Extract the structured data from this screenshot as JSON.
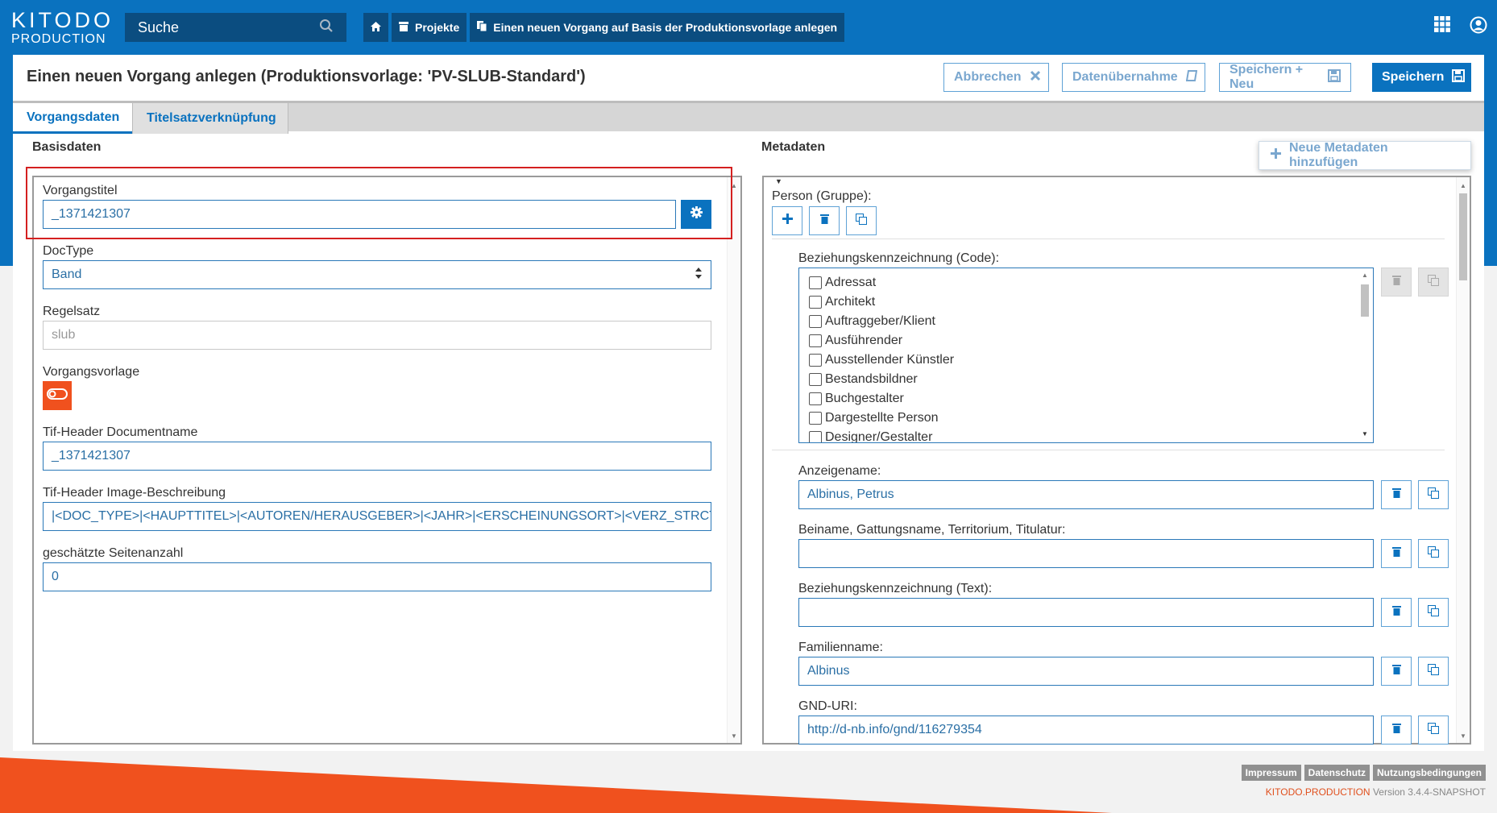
{
  "header": {
    "logo_line1": "KITODO",
    "logo_line2": "PRODUCTION",
    "search_placeholder": "Suche",
    "breadcrumbs": [
      {
        "label": ""
      },
      {
        "label": "Projekte"
      },
      {
        "label": "Einen neuen Vorgang auf Basis der Produktionsvorlage anlegen"
      }
    ]
  },
  "page": {
    "title": "Einen neuen Vorgang anlegen (Produktionsvorlage: 'PV-SLUB-Standard')",
    "buttons": {
      "cancel": "Abbrechen",
      "import": "Datenübernahme",
      "save_new": "Speichern + Neu",
      "save": "Speichern"
    },
    "tabs": [
      "Vorgangsdaten",
      "Titelsatzverknüpfung"
    ]
  },
  "basisdaten": {
    "section_title": "Basisdaten",
    "vorgangstitel_label": "Vorgangstitel",
    "vorgangstitel_value": "_1371421307",
    "doctype_label": "DocType",
    "doctype_value": "Band",
    "regelsatz_label": "Regelsatz",
    "regelsatz_value": "slub",
    "vorgangsvorlage_label": "Vorgangsvorlage",
    "tif_doc_label": "Tif-Header Documentname",
    "tif_doc_value": "_1371421307",
    "tif_img_label": "Tif-Header Image-Beschreibung",
    "tif_img_value": "|<DOC_TYPE>|<HAUPTTITEL>|<AUTOREN/HERAUSGEBER>|<JAHR>|<ERSCHEINUNGSORT>|<VERZ_STRCT>|",
    "pages_label": "geschätzte Seitenanzahl",
    "pages_value": "0"
  },
  "metadaten": {
    "section_title": "Metadaten",
    "add_button": "Neue Metadaten hinzufügen",
    "person_group_label": "Person (Gruppe):",
    "relation_code_label": "Beziehungskennzeichnung (Code):",
    "relation_code_options": [
      "Adressat",
      "Architekt",
      "Auftraggeber/Klient",
      "Ausführender",
      "Ausstellender Künstler",
      "Bestandsbildner",
      "Buchgestalter",
      "Dargestellte Person",
      "Designer/Gestalter"
    ],
    "fields": [
      {
        "label": "Anzeigename:",
        "value": "Albinus, Petrus"
      },
      {
        "label": "Beiname, Gattungsname, Territorium, Titulatur:",
        "value": ""
      },
      {
        "label": "Beziehungskennzeichnung (Text):",
        "value": ""
      },
      {
        "label": "Familienname:",
        "value": "Albinus"
      },
      {
        "label": "GND-URI:",
        "value": "http://d-nb.info/gnd/116279354"
      }
    ]
  },
  "footer": {
    "links": [
      "Impressum",
      "Datenschutz",
      "Nutzungsbedingungen"
    ],
    "brand": "KITODO.PRODUCTION",
    "version": "Version 3.4.4-SNAPSHOT"
  },
  "colors": {
    "primary": "#0a72bf",
    "dark_blue": "#0b4d80",
    "accent_orange": "#f0511e",
    "highlight_red": "#d42020"
  }
}
